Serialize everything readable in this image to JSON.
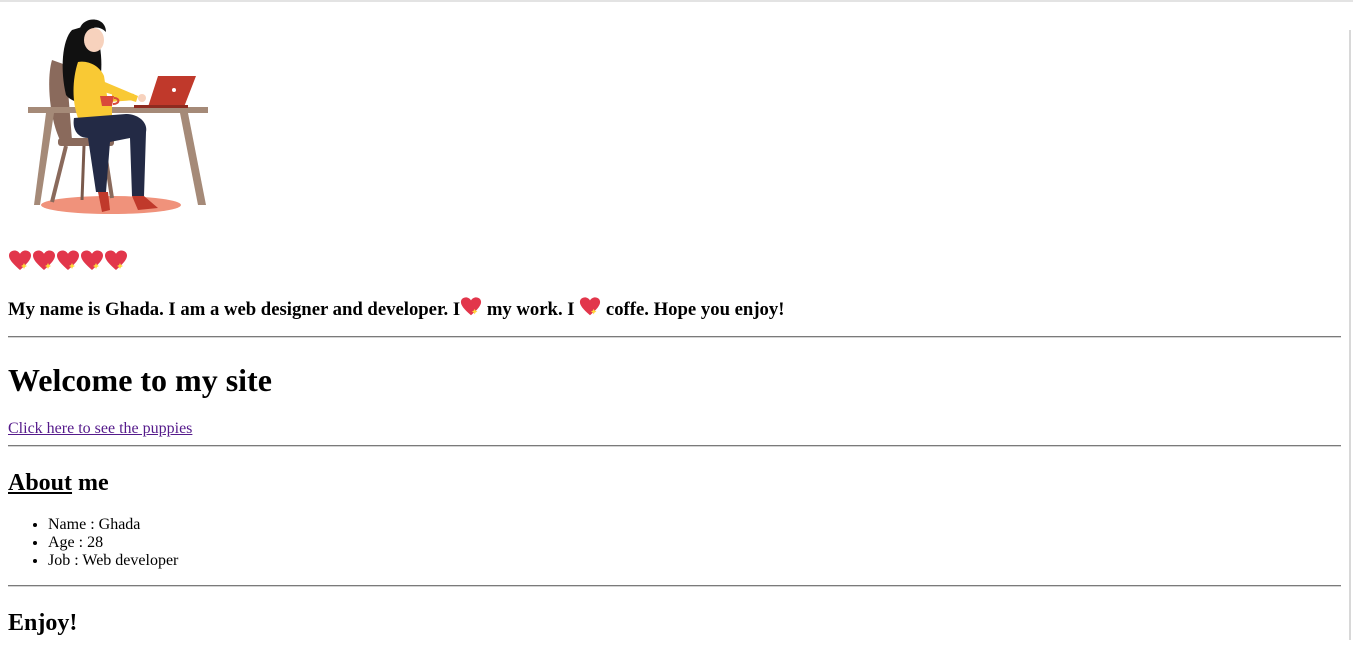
{
  "hero": {
    "image_alt": "woman working at laptop illustration"
  },
  "hearts": {
    "count": 5,
    "icon": "sparkling-heart-icon",
    "color": "#e2364b"
  },
  "intro": {
    "part1": "My name is Ghada. I am a web designer and developer. I",
    "part2": " my work. I ",
    "part3": " coffe. Hope you enjoy!"
  },
  "welcome": {
    "title": "Welcome to my site"
  },
  "link": {
    "label": "Click here to see the puppies",
    "color": "#551a8b"
  },
  "about": {
    "word1": "About",
    "word2": " me",
    "items": [
      "Name : Ghada",
      "Age : 28",
      "Job : Web developer"
    ]
  },
  "footer": {
    "title": "Enjoy!"
  }
}
